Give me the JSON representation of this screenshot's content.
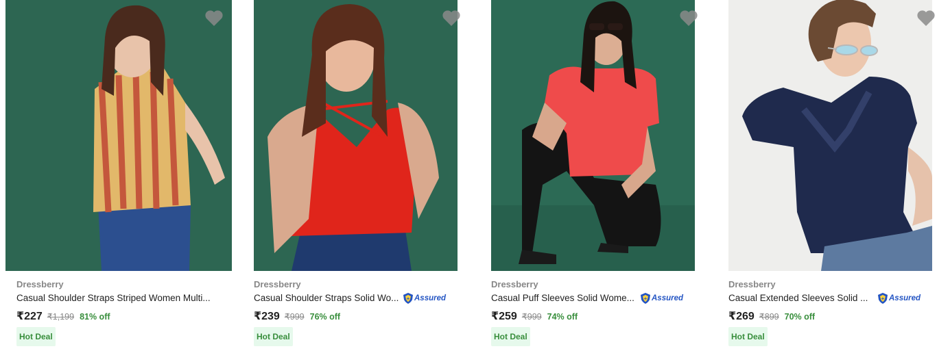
{
  "colors": {
    "background": "#ffffff",
    "image_bg_green": "#2d6652",
    "image_bg_light": "#eeeeec",
    "wishlist_heart": "#8a8a8a",
    "offer_green": "#388e3c",
    "deal_bg": "#e6f9ec",
    "assured_blue": "#2455c3"
  },
  "products": [
    {
      "brand": "Dressberry",
      "title": "Casual Shoulder Straps Striped Women Multi...",
      "assured": false,
      "price": "₹227",
      "mrp": "₹1,199",
      "discount": "81% off",
      "tag": "Hot Deal",
      "wishlist_icon": "heart-icon"
    },
    {
      "brand": "Dressberry",
      "title": "Casual Shoulder Straps Solid Wo...",
      "assured": true,
      "assured_label": "Assured",
      "price": "₹239",
      "mrp": "₹999",
      "discount": "76% off",
      "tag": "Hot Deal",
      "wishlist_icon": "heart-icon"
    },
    {
      "brand": "Dressberry",
      "title": "Casual Puff Sleeves Solid Wome...",
      "assured": true,
      "assured_label": "Assured",
      "price": "₹259",
      "mrp": "₹999",
      "discount": "74% off",
      "tag": "Hot Deal",
      "wishlist_icon": "heart-icon"
    },
    {
      "brand": "Dressberry",
      "title": "Casual Extended Sleeves Solid ...",
      "assured": true,
      "assured_label": "Assured",
      "price": "₹269",
      "mrp": "₹899",
      "discount": "70% off",
      "tag": "Hot Deal",
      "wishlist_icon": "heart-icon"
    }
  ]
}
